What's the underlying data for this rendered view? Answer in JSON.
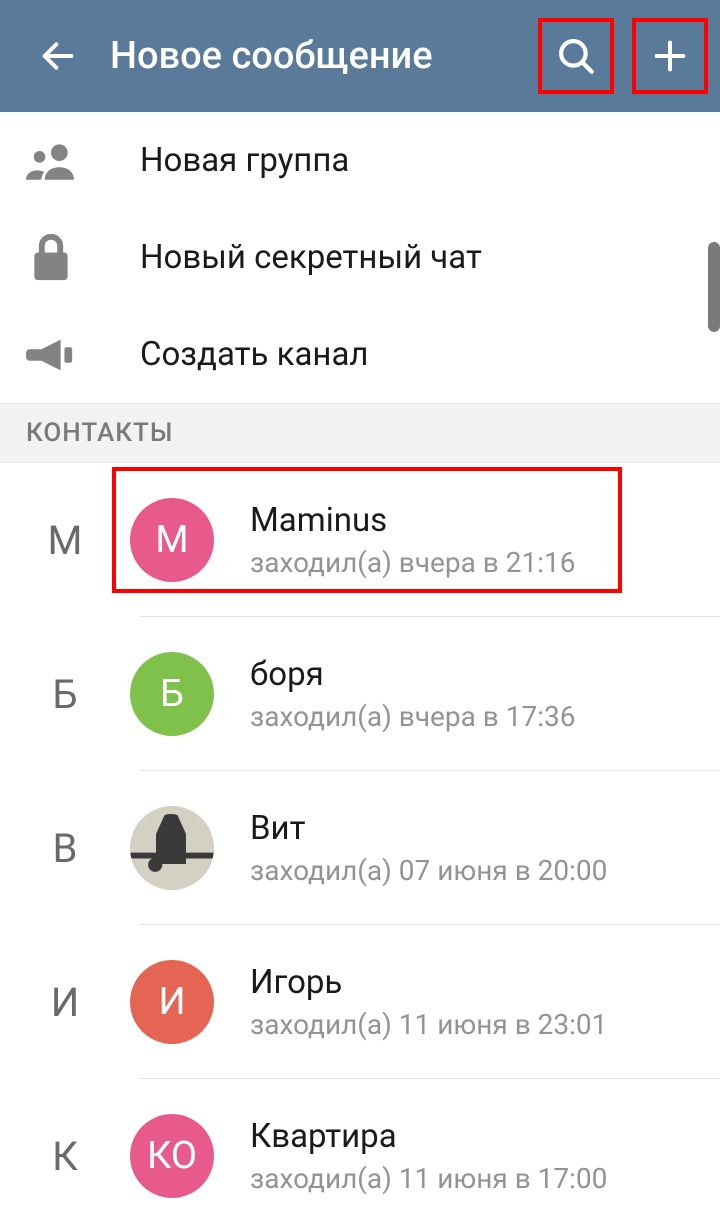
{
  "header": {
    "title": "Новое сообщение"
  },
  "actions": [
    {
      "label": "Новая группа",
      "icon": "group"
    },
    {
      "label": "Новый секретный чат",
      "icon": "lock"
    },
    {
      "label": "Создать канал",
      "icon": "megaphone"
    }
  ],
  "section": {
    "title": "КОНТАКТЫ"
  },
  "contacts": [
    {
      "letter": "М",
      "avatar_text": "М",
      "avatar_color": "#e85a8c",
      "name": "Maminus",
      "status": "заходил(а) вчера в 21:16",
      "highlighted": true
    },
    {
      "letter": "Б",
      "avatar_text": "Б",
      "avatar_color": "#7fc14b",
      "name": "боря",
      "status": "заходил(а) вчера в 17:36",
      "highlighted": false
    },
    {
      "letter": "В",
      "avatar_text": "",
      "avatar_color": "img",
      "name": "Вит",
      "status": "заходил(а) 07 июня в 20:00",
      "highlighted": false
    },
    {
      "letter": "И",
      "avatar_text": "И",
      "avatar_color": "#e56554",
      "name": "Игорь",
      "status": "заходил(а) 11 июня в 23:01",
      "highlighted": false
    },
    {
      "letter": "К",
      "avatar_text": "КО",
      "avatar_color": "#e85a8c",
      "name": "Квартира",
      "status": "заходил(а) 11 июня в 17:00",
      "highlighted": false
    }
  ]
}
